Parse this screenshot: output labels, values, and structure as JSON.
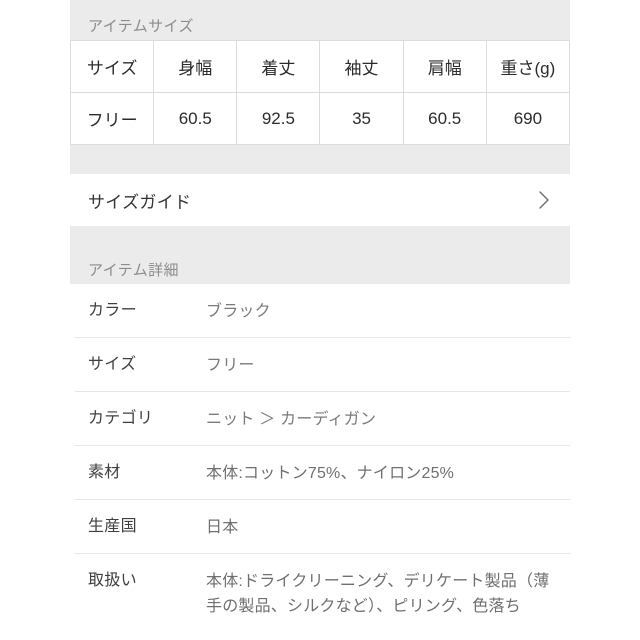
{
  "size_section": {
    "title": "アイテムサイズ",
    "table": {
      "headers": [
        "サイズ",
        "身幅",
        "着丈",
        "袖丈",
        "肩幅",
        "重さ(g)"
      ],
      "rows": [
        [
          "フリー",
          "60.5",
          "92.5",
          "35",
          "60.5",
          "690"
        ]
      ]
    }
  },
  "size_guide": {
    "label": "サイズガイド",
    "chevron_icon": "chevron-right-icon"
  },
  "detail_section": {
    "title": "アイテム詳細",
    "rows": [
      {
        "label": "カラー",
        "value": "ブラック"
      },
      {
        "label": "サイズ",
        "value": "フリー"
      },
      {
        "label": "カテゴリ",
        "value": "ニット ＞ カーディガン"
      },
      {
        "label": "素材",
        "value": "本体:コットン75%、ナイロン25%"
      },
      {
        "label": "生産国",
        "value": "日本"
      },
      {
        "label": "取扱い",
        "value": "本体:ドライクリーニング、デリケート製品（薄手の製品、シルクなど）、ピリング、色落ち"
      }
    ]
  },
  "colors": {
    "band_background": "#ebebeb",
    "band_text": "#8c8c8c",
    "label_text": "#3f3f3f",
    "value_text": "#7a7a7a",
    "table_border": "#dcdcdc",
    "divider": "#e6e6e6",
    "page_background": "#ffffff"
  }
}
